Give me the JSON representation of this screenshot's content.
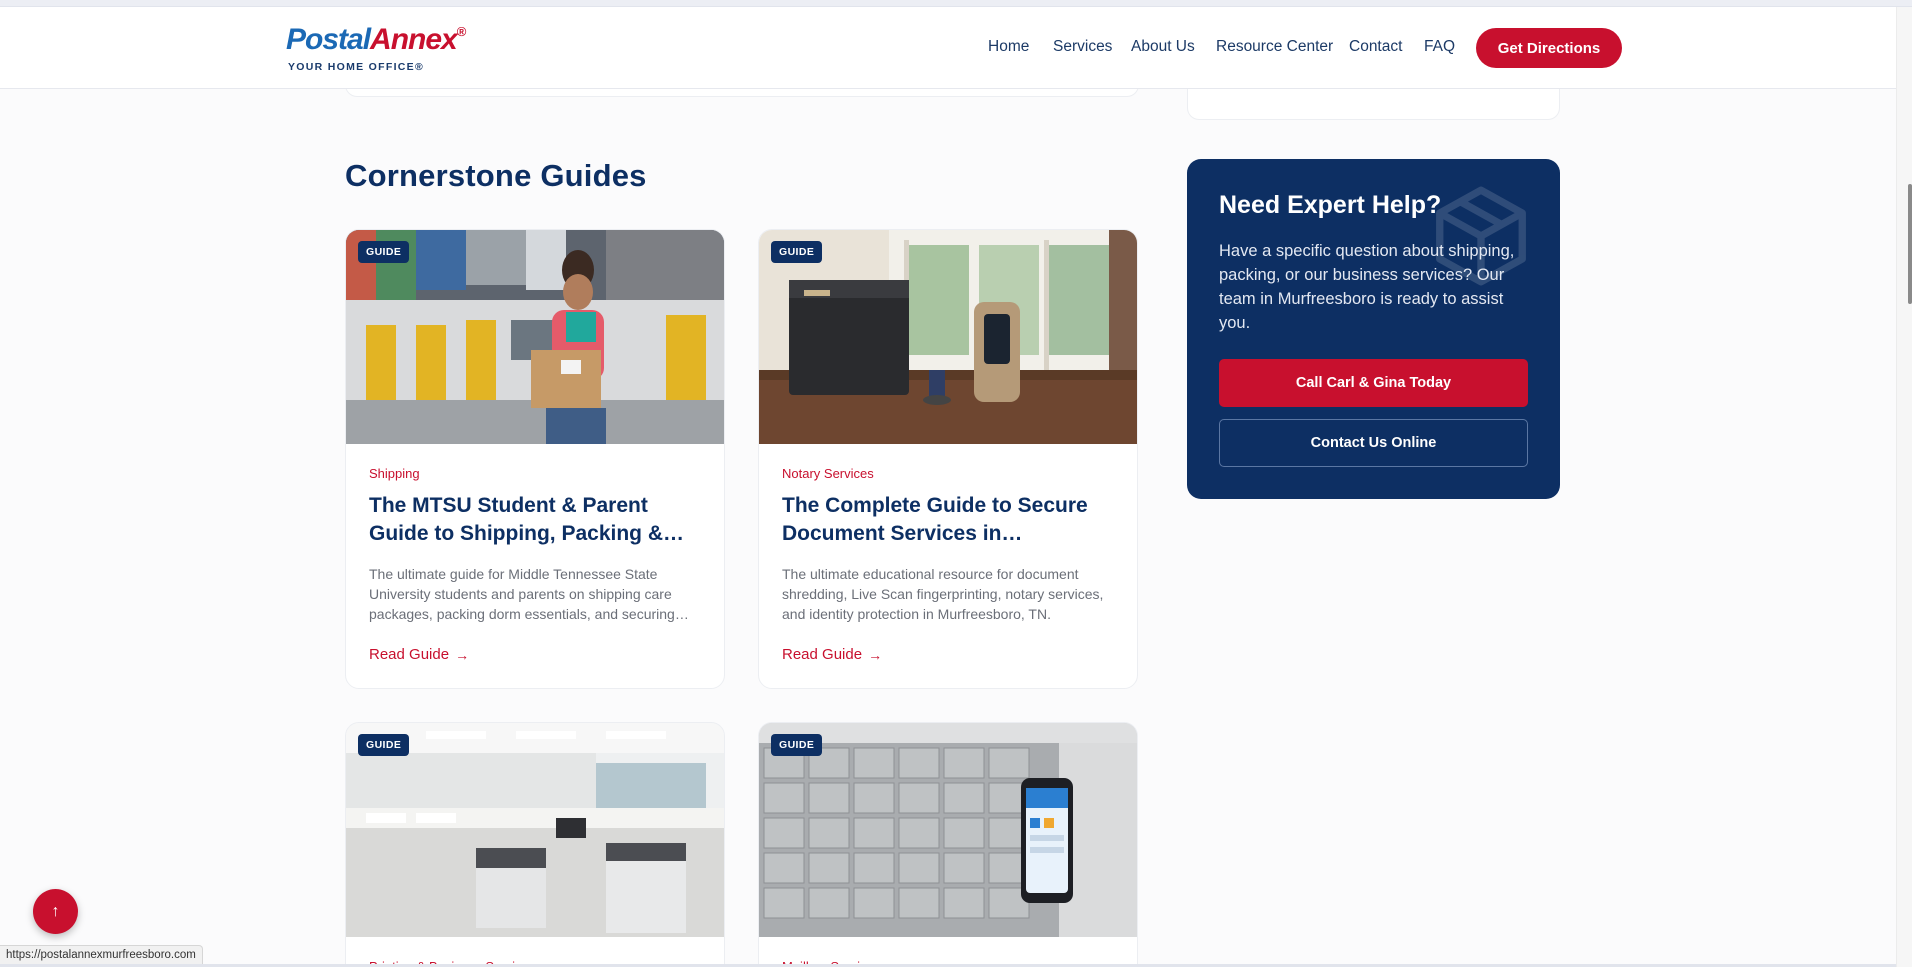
{
  "header": {
    "logo": {
      "part1": "Postal",
      "part2": "Annex",
      "reg": "®",
      "tagline": "YOUR HOME OFFICE®"
    },
    "nav": [
      "Home",
      "Services",
      "About Us",
      "Resource Center",
      "Contact",
      "FAQ"
    ],
    "cta": "Get Directions"
  },
  "section": {
    "title": "Cornerstone Guides"
  },
  "cards": [
    {
      "badge": "GUIDE",
      "category": "Shipping",
      "title": "The MTSU Student & Parent Guide to Shipping, Packing & Storage",
      "desc": "The ultimate guide for Middle Tennessee State University students and parents on shipping care packages, packing dorm essentials, and securing mail.",
      "link": "Read Guide"
    },
    {
      "badge": "GUIDE",
      "category": "Notary Services",
      "title": "The Complete Guide to Secure Document Services in Murfreesboro",
      "desc": "The ultimate educational resource for document shredding, Live Scan fingerprinting, notary services, and identity protection in Murfreesboro, TN.",
      "link": "Read Guide"
    },
    {
      "badge": "GUIDE",
      "category": "Printing & Business Services",
      "title": "",
      "desc": "",
      "link": ""
    },
    {
      "badge": "GUIDE",
      "category": "Mailbox Services",
      "title": "",
      "desc": "",
      "link": ""
    }
  ],
  "help": {
    "title": "Need Expert Help?",
    "text": "Have a specific question about shipping, packing, or our business services? Our team in Murfreesboro is ready to assist you.",
    "primary": "Call Carl & Gina Today",
    "secondary": "Contact Us Online"
  },
  "status_url": "https://postalannexmurfreesboro.com",
  "colors": {
    "brand_red": "#c8102e",
    "brand_navy": "#0d2f63",
    "brand_blue": "#1b69b5"
  },
  "icons": {
    "arrow": "arrow-right-icon",
    "to_top": "arrow-up-icon",
    "help_bg": "box-icon"
  }
}
